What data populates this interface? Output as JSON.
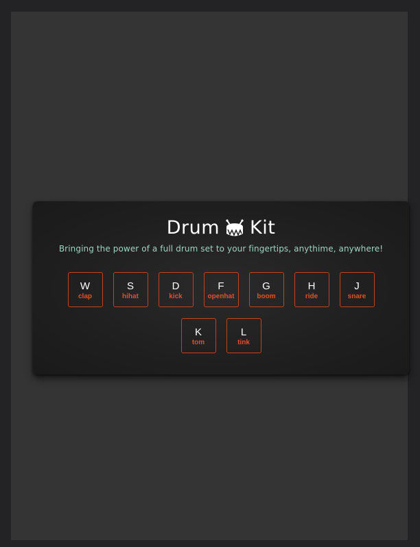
{
  "app": {
    "title_left": "Drum",
    "title_right": "Kit",
    "title_icon": "drum-icon",
    "subtitle": "Bringing the power of a full drum set to your fingertips, anythime, anywhere!"
  },
  "colors": {
    "page_bg": "#232326",
    "frame_bg": "#343434",
    "card_bg": "#1f1f1f",
    "accent": "#e2502a",
    "subtitle": "#9fd3c0"
  },
  "keys_row1": [
    {
      "key": "W",
      "sound": "clap"
    },
    {
      "key": "S",
      "sound": "hihat"
    },
    {
      "key": "D",
      "sound": "kick"
    },
    {
      "key": "F",
      "sound": "openhat"
    },
    {
      "key": "G",
      "sound": "boom"
    },
    {
      "key": "H",
      "sound": "ride"
    },
    {
      "key": "J",
      "sound": "snare"
    }
  ],
  "keys_row2": [
    {
      "key": "K",
      "sound": "tom"
    },
    {
      "key": "L",
      "sound": "tink"
    }
  ]
}
